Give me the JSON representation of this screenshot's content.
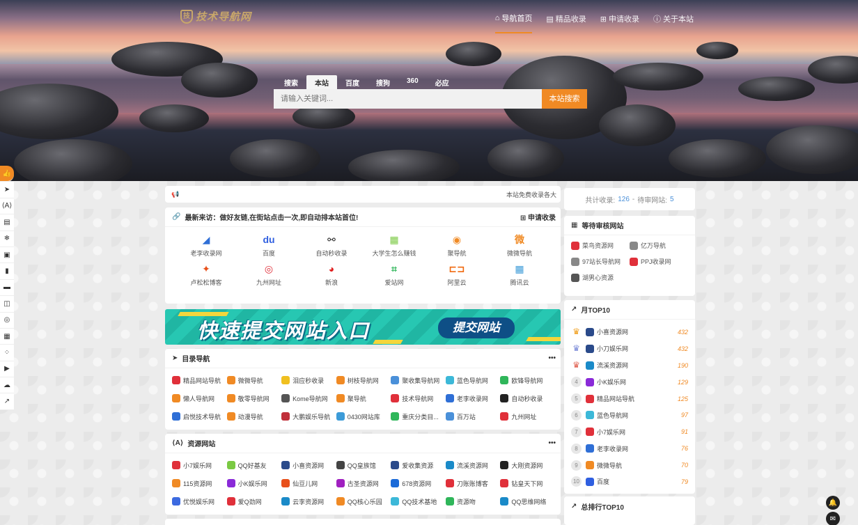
{
  "logo": {
    "text": "技术导航网",
    "mark": "技"
  },
  "nav": [
    {
      "label": "导航首页",
      "icon": "home-icon",
      "glyph": "⌂"
    },
    {
      "label": "精品收录",
      "icon": "book-icon",
      "glyph": "▤"
    },
    {
      "label": "申请收录",
      "icon": "plus-icon",
      "glyph": "⊞"
    },
    {
      "label": "关于本站",
      "icon": "info-icon",
      "glyph": "ⓘ"
    }
  ],
  "search": {
    "tabs": [
      "搜索",
      "本站",
      "百度",
      "搜狗",
      "360",
      "必应"
    ],
    "active_tab": "本站",
    "placeholder": "请输入关键词...",
    "button": "本站搜索"
  },
  "sidebar": [
    "👍",
    "➤",
    "⟨A⟩",
    "▤",
    "❄",
    "▣",
    "▮",
    "▬",
    "◫",
    "◎",
    "▦",
    "⁘",
    "▶",
    "☁",
    "↗"
  ],
  "notice": {
    "icon": "megaphone-icon",
    "text": "本站免费收录各大"
  },
  "visits": {
    "title": "最新来访：做好友链,在街站点击一次,即自动排本站首位!",
    "apply": "申请收录",
    "items": [
      {
        "label": "老李收录网",
        "glyph": "◢",
        "color": "#2f6fd6"
      },
      {
        "label": "百度",
        "glyph": "du",
        "color": "#2f5fe0"
      },
      {
        "label": "自动秒收录",
        "glyph": "⚯",
        "color": "#222222"
      },
      {
        "label": "大学生怎么赚钱",
        "glyph": "▦",
        "color": "#7ac943"
      },
      {
        "label": "聚导航",
        "glyph": "◉",
        "color": "#f08a24"
      },
      {
        "label": "微微导航",
        "glyph": "微",
        "color": "#f08a24"
      },
      {
        "label": "卢松松博客",
        "glyph": "✦",
        "color": "#e8501a"
      },
      {
        "label": "九州网址",
        "glyph": "◎",
        "color": "#e0303a"
      },
      {
        "label": "新浪",
        "glyph": "◕",
        "color": "#e02020"
      },
      {
        "label": "爱站网",
        "glyph": "⌗",
        "color": "#2fb65a"
      },
      {
        "label": "阿里云",
        "glyph": "⊏⊐",
        "color": "#f06a10"
      },
      {
        "label": "腾讯云",
        "glyph": "▦",
        "color": "#3c9bd8"
      }
    ]
  },
  "banner": {
    "title": "快速提交网站入口",
    "button": "提交网站"
  },
  "directory": {
    "title": "目录导航",
    "items": [
      {
        "label": "精品网站导航",
        "color": "#e0303a"
      },
      {
        "label": "微微导航",
        "color": "#f08a24"
      },
      {
        "label": "泪应秒收录",
        "color": "#f0c020"
      },
      {
        "label": "树枝导航网",
        "color": "#f08a24"
      },
      {
        "label": "聚收集导航网",
        "color": "#4a90d9"
      },
      {
        "label": "蓝色导航网",
        "color": "#3cb8d8"
      },
      {
        "label": "欧锋导航网",
        "color": "#2fb65a"
      },
      {
        "label": "懒人导航网",
        "color": "#f08a24"
      },
      {
        "label": "敬零导航网",
        "color": "#f08a24"
      },
      {
        "label": "Kome导航网",
        "color": "#555555"
      },
      {
        "label": "聚导航",
        "color": "#f08a24"
      },
      {
        "label": "技术导航网",
        "color": "#e0303a"
      },
      {
        "label": "老李收录网",
        "color": "#2f6fd6"
      },
      {
        "label": "自动秒收录",
        "color": "#222222"
      },
      {
        "label": "启悦技术导航",
        "color": "#2f6fd6"
      },
      {
        "label": "动漫导航",
        "color": "#f08a24"
      },
      {
        "label": "大鹏娱乐导航",
        "color": "#c0303a"
      },
      {
        "label": "0430网站库",
        "color": "#3c9bd8"
      },
      {
        "label": "重庆分类目...",
        "color": "#2fb65a"
      },
      {
        "label": "百万站",
        "color": "#4a90d9"
      },
      {
        "label": "九州网址",
        "color": "#e0303a"
      }
    ]
  },
  "resources": {
    "title": "资源网站",
    "items": [
      {
        "label": "小7娱乐网",
        "color": "#e0303a"
      },
      {
        "label": "QQ好基友",
        "color": "#7ac943"
      },
      {
        "label": "小喜资源网",
        "color": "#2a4a8a"
      },
      {
        "label": "QQ皇族馆",
        "color": "#444444"
      },
      {
        "label": "爱收集资源",
        "color": "#2a4a8a"
      },
      {
        "label": "流溪资源网",
        "color": "#1a8ac8"
      },
      {
        "label": "大刚资源网",
        "color": "#222222"
      },
      {
        "label": "115资源网",
        "color": "#f08a24"
      },
      {
        "label": "小K娱乐网",
        "color": "#8a2ad8"
      },
      {
        "label": "仙豆儿网",
        "color": "#e8501a"
      },
      {
        "label": "古圣资源网",
        "color": "#a020c0"
      },
      {
        "label": "678资源网",
        "color": "#1a6ad8"
      },
      {
        "label": "刀账账博客",
        "color": "#e0303a"
      },
      {
        "label": "钻皇天下网",
        "color": "#e0303a"
      },
      {
        "label": "优悦娱乐网",
        "color": "#3c6ae0"
      },
      {
        "label": "爱Q劲网",
        "color": "#e0303a"
      },
      {
        "label": "云李资源网",
        "color": "#1a8ac8"
      },
      {
        "label": "QQ核心乐园",
        "color": "#f08a24"
      },
      {
        "label": "QQ技术基地",
        "color": "#3cb8d8"
      },
      {
        "label": "资源吻",
        "color": "#2fb65a"
      },
      {
        "label": "QQ思维网络",
        "color": "#1a8ac8"
      }
    ]
  },
  "stats": {
    "label1": "共计收录:",
    "count1": "126",
    "sep": "-",
    "label2": "待审网站:",
    "count2": "5"
  },
  "pending": {
    "title": "等待审核网站",
    "items": [
      {
        "label": "菜鸟资源网",
        "color": "#e0303a"
      },
      {
        "label": "亿万导航",
        "color": "#888888"
      },
      {
        "label": "97站长导航网",
        "color": "#888888"
      },
      {
        "label": "PPJ收录网",
        "color": "#e0303a"
      },
      {
        "label": "湖男心资源",
        "color": "#555555"
      }
    ]
  },
  "month_top": {
    "title": "月TOP10",
    "rows": [
      {
        "rank": "1",
        "name": "小喜资源网",
        "value": "432",
        "medal": "#f0a020",
        "color": "#2a4a8a"
      },
      {
        "rank": "2",
        "name": "小刀娱乐网",
        "value": "432",
        "medal": "#7a8ad8",
        "color": "#2a4a8a"
      },
      {
        "rank": "3",
        "name": "流溪资源网",
        "value": "190",
        "medal": "#e06050",
        "color": "#1a8ac8"
      },
      {
        "rank": "4",
        "name": "小K娱乐网",
        "value": "129",
        "medal": "",
        "color": "#8a2ad8"
      },
      {
        "rank": "5",
        "name": "精品网站导航",
        "value": "125",
        "medal": "",
        "color": "#e0303a"
      },
      {
        "rank": "6",
        "name": "蓝色导航网",
        "value": "97",
        "medal": "",
        "color": "#3cb8d8"
      },
      {
        "rank": "7",
        "name": "小7娱乐网",
        "value": "91",
        "medal": "",
        "color": "#e0303a"
      },
      {
        "rank": "8",
        "name": "老李收录网",
        "value": "76",
        "medal": "",
        "color": "#2f6fd6"
      },
      {
        "rank": "9",
        "name": "微微导航",
        "value": "70",
        "medal": "",
        "color": "#f08a24"
      },
      {
        "rank": "10",
        "name": "百度",
        "value": "79",
        "medal": "",
        "color": "#2f5fe0"
      }
    ]
  },
  "total_top": {
    "title": "总排行TOP10"
  },
  "float": {
    "bell": "🔔",
    "mail": "✉"
  }
}
